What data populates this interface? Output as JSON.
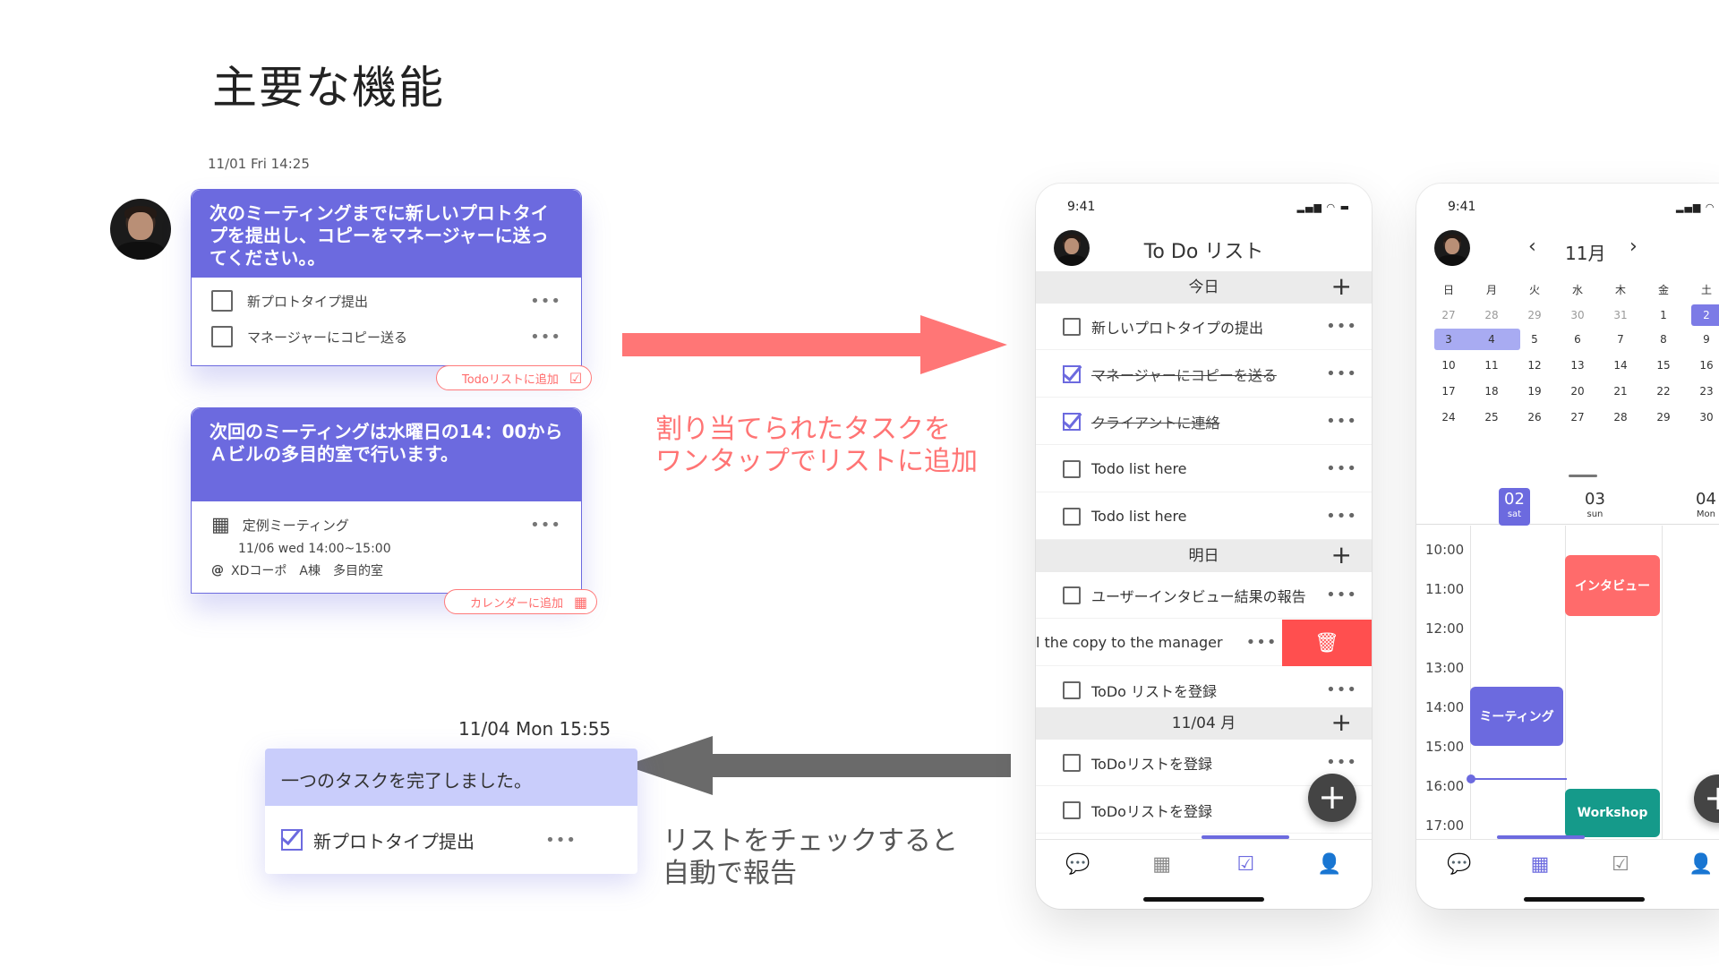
{
  "slide": {
    "title": "主要な機能"
  },
  "chat": {
    "timestamp1": "11/01 Fri 14:25",
    "message1": "次のミーティングまでに新しいプロトタイプを提出し、コピーをマネージャーに送ってください。。",
    "tasks": [
      {
        "label": "新プロトタイプ提出",
        "more": "•••"
      },
      {
        "label": "マネージャーにコピー送る",
        "more": "•••"
      }
    ],
    "add_todo_label": "Todoリストに追加",
    "message2": "次回のミーティングは水曜日の14：00からＡビルの多目的室で行います。",
    "event": {
      "title": "定例ミーティング",
      "datetime": "11/06 wed 14:00~15:00",
      "at": "@",
      "location": "XDコーポ　A棟　多目的室",
      "more": "•••"
    },
    "add_calendar_label": "カレンダーに追加",
    "timestamp2": "11/04 Mon 15:55",
    "completed_message": "一つのタスクを完了しました。",
    "completed_task": "新プロトタイプ提出",
    "completed_more": "•••"
  },
  "captions": {
    "assign": "割り当てられたタスクを\nワンタップでリストに追加",
    "report": "リストをチェックすると\n自動で報告"
  },
  "todo_phone": {
    "time": "9:41",
    "title": "To Do リスト",
    "sections": {
      "today": "今日",
      "tomorrow": "明日",
      "date": "11/04 月"
    },
    "today_rows": [
      {
        "label": "新しいプロトタイプの提出",
        "done": false
      },
      {
        "label": "マネージャーにコピーを送る",
        "done": true
      },
      {
        "label": "クライアントに連絡",
        "done": true
      },
      {
        "label": "Todo list here",
        "done": false
      },
      {
        "label": "Todo list here",
        "done": false
      }
    ],
    "tomorrow_rows": [
      {
        "label": "ユーザーインタビュー結果の報告"
      },
      {
        "label": "l the copy to the manager"
      },
      {
        "label": "ToDo リストを登録"
      }
    ],
    "date_rows": [
      {
        "label": "ToDoリストを登録"
      },
      {
        "label": "ToDoリストを登録"
      }
    ],
    "more": "•••",
    "plus": "+",
    "delete_icon": "trash-icon"
  },
  "calendar_phone": {
    "time": "9:41",
    "month": "11月",
    "weekdays": [
      "日",
      "月",
      "火",
      "水",
      "木",
      "金",
      "土"
    ],
    "weeks": [
      [
        "27",
        "28",
        "29",
        "30",
        "31",
        "1",
        "2"
      ],
      [
        "3",
        "4",
        "5",
        "6",
        "7",
        "8",
        "9"
      ],
      [
        "10",
        "11",
        "12",
        "13",
        "14",
        "15",
        "16"
      ],
      [
        "17",
        "18",
        "19",
        "20",
        "21",
        "22",
        "23"
      ],
      [
        "24",
        "25",
        "26",
        "27",
        "28",
        "29",
        "30"
      ]
    ],
    "days": [
      {
        "num": "02",
        "dow": "sat"
      },
      {
        "num": "03",
        "dow": "sun"
      },
      {
        "num": "04",
        "dow": "Mon"
      }
    ],
    "times": [
      "10:00",
      "11:00",
      "12:00",
      "13:00",
      "14:00",
      "15:00",
      "16:00",
      "17:00"
    ],
    "events": {
      "interview": "インタビュー",
      "meeting": "ミーティング",
      "workshop": "Workshop"
    },
    "accent": "#6c6adf",
    "interview_color": "#ff6b6b",
    "workshop_color": "#159a8a"
  }
}
